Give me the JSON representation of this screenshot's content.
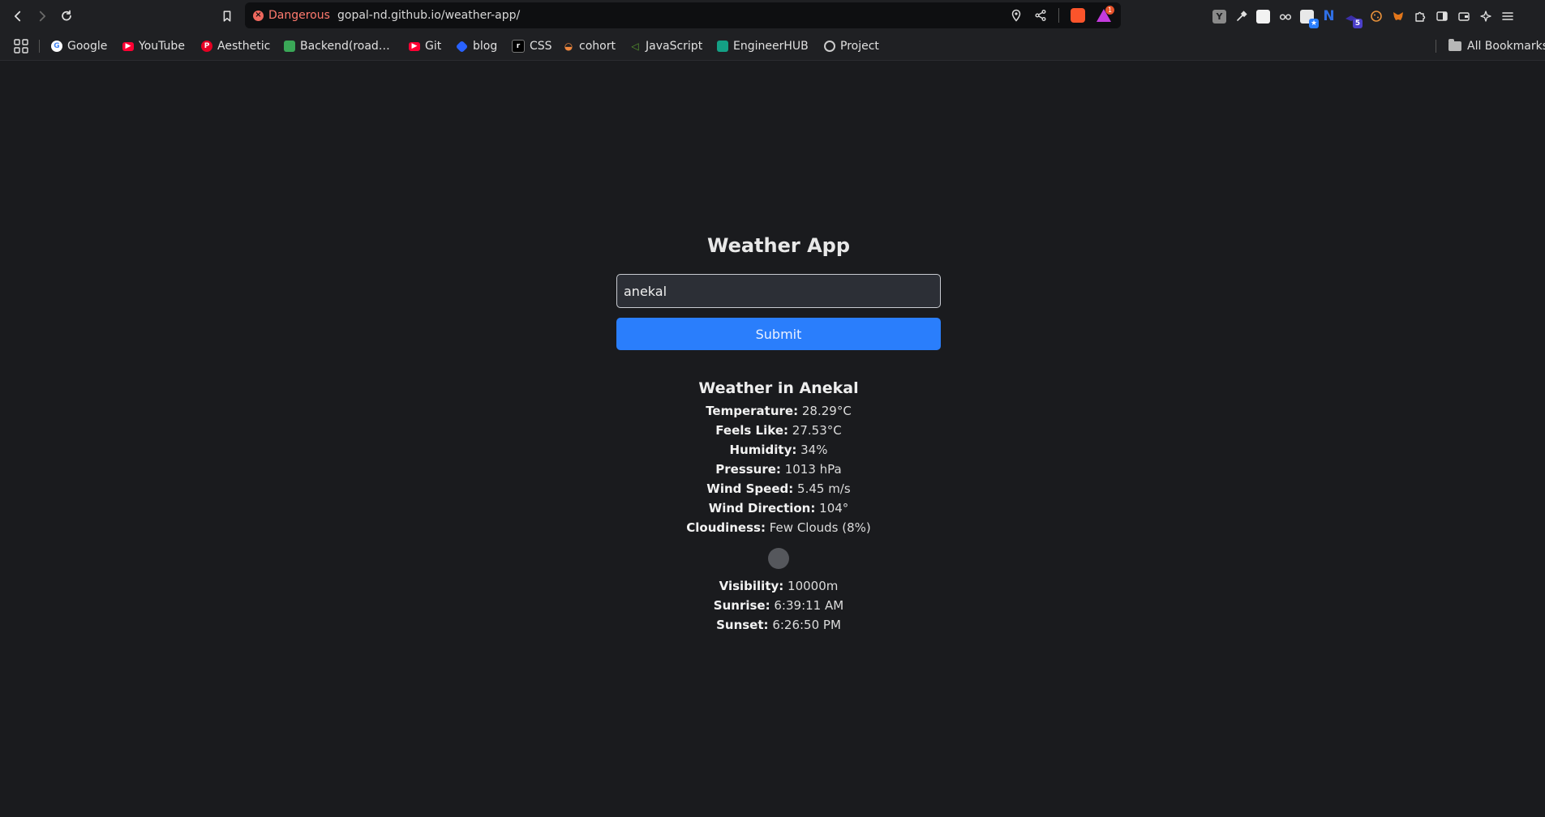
{
  "browser": {
    "security_label": "Dangerous",
    "url": "gopal-nd.github.io/weather-app/",
    "rewards_count": "1",
    "extension_badge": "5",
    "extension_letters": {
      "y": "Y",
      "n": "N"
    }
  },
  "bookmarks": {
    "items": [
      {
        "label": "Google",
        "color": "#4285f4"
      },
      {
        "label": "YouTube",
        "color": "#ff0033"
      },
      {
        "label": "Aesthetic",
        "color": "#e60023"
      },
      {
        "label": "Backend(road…",
        "color": "#3aa757"
      },
      {
        "label": "Git",
        "color": "#ff0033"
      },
      {
        "label": "blog",
        "color": "#2962ff"
      },
      {
        "label": "CSS",
        "color": "#000000"
      },
      {
        "label": "cohort",
        "color": "#f0883e"
      },
      {
        "label": "JavaScript",
        "color": "#5a9e2f"
      },
      {
        "label": "EngineerHUB",
        "color": "#14a085"
      },
      {
        "label": "Project",
        "color": "#cccccc"
      }
    ],
    "all_label": "All Bookmarks"
  },
  "app": {
    "title": "Weather App",
    "input_value": "anekal",
    "submit_label": "Submit",
    "result": {
      "title": "Weather in Anekal",
      "temperature_label": "Temperature:",
      "temperature_value": "28.29°C",
      "feels_like_label": "Feels Like:",
      "feels_like_value": "27.53°C",
      "humidity_label": "Humidity:",
      "humidity_value": "34%",
      "pressure_label": "Pressure:",
      "pressure_value": "1013 hPa",
      "wind_speed_label": "Wind Speed:",
      "wind_speed_value": "5.45 m/s",
      "wind_direction_label": "Wind Direction:",
      "wind_direction_value": "104°",
      "cloudiness_label": "Cloudiness:",
      "cloudiness_value": "Few Clouds (8%)",
      "visibility_label": "Visibility:",
      "visibility_value": "10000m",
      "sunrise_label": "Sunrise:",
      "sunrise_value": "6:39:11 AM",
      "sunset_label": "Sunset:",
      "sunset_value": "6:26:50 PM"
    }
  },
  "colors": {
    "page_background": "#1a1b1e",
    "chrome_background": "#1f2023",
    "button_blue": "#2a7efc",
    "danger_red": "#ff7a6e"
  }
}
